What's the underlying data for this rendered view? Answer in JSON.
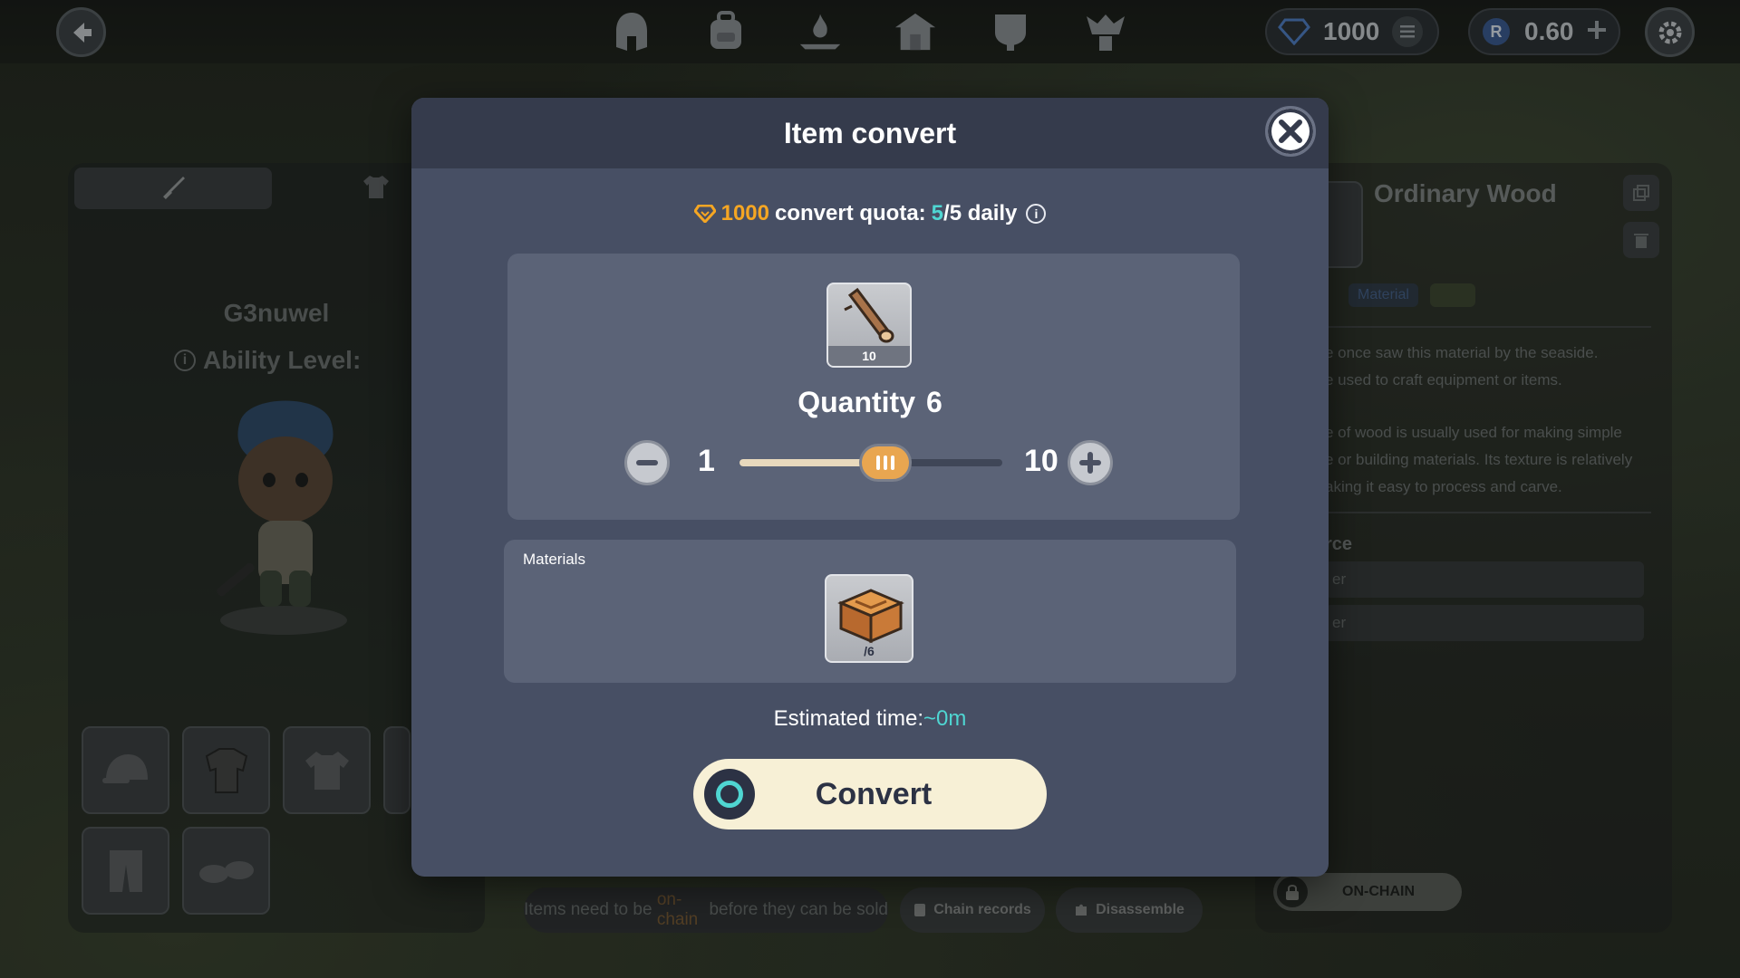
{
  "topbar": {
    "nav_icons": [
      "helmet-icon",
      "backpack-icon",
      "forge-icon",
      "guild-icon",
      "arena-icon",
      "trophy-icon"
    ],
    "gems": {
      "value": "1000"
    },
    "token": {
      "value": "0.60"
    }
  },
  "character": {
    "name": "G3nuwel",
    "ability_label": "Ability Level:"
  },
  "detail": {
    "title": "Ordinary Wood",
    "tag_material": "Material",
    "description_1": "e once saw this material by the seaside.\ne used to craft equipment or items.",
    "description_2": "e of wood is usually used for making simple\ne or building materials. Its texture is relatively\naking it easy to process and carve.",
    "section_label": "rce",
    "rows": [
      "er",
      "er"
    ],
    "onchain_label": "ON-CHAIN"
  },
  "bottom": {
    "note_pre": "Items need to be ",
    "note_hl": "on-chain",
    "note_post": " before they can be sold",
    "chain_records": "Chain records",
    "disassemble": "Disassemble"
  },
  "modal": {
    "title": "Item convert",
    "quota": {
      "amount": "1000",
      "label": "convert quota:",
      "used": "5",
      "rest": "/5 daily"
    },
    "item": {
      "name": "Ordinary Wood",
      "count": "10",
      "icon": "wood-log-icon"
    },
    "quantity_label": "Quantity",
    "quantity_value": "6",
    "slider": {
      "min": "1",
      "max": "10",
      "value": 6
    },
    "materials_label": "Materials",
    "material": {
      "count": "/6",
      "icon": "crate-icon"
    },
    "est_label": "Estimated time:",
    "est_value": "~0m",
    "convert_label": "Convert"
  },
  "colors": {
    "accent_teal": "#4fd6d2",
    "accent_gold": "#f5a623",
    "modal_bg": "#474f64",
    "button_cream": "#f7f0d6"
  }
}
